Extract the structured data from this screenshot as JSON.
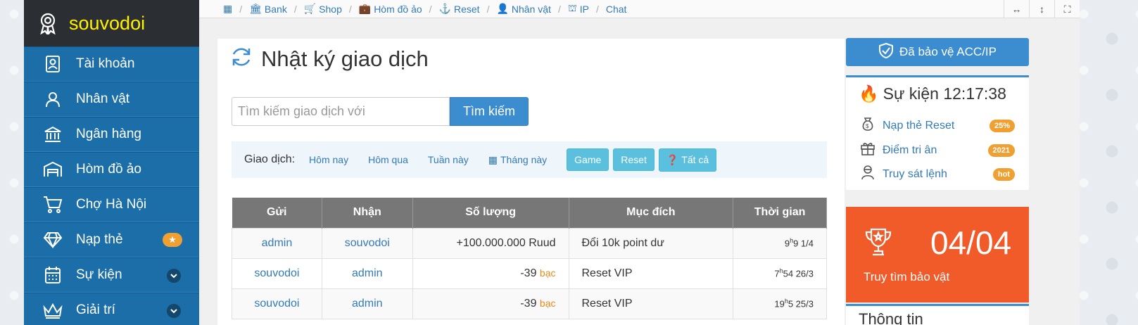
{
  "brand": {
    "name": "souvodoi"
  },
  "sidebar": {
    "items": [
      {
        "label": "Tài khoản"
      },
      {
        "label": "Nhân vật"
      },
      {
        "label": "Ngân hàng"
      },
      {
        "label": "Hòm đồ ảo"
      },
      {
        "label": "Chợ Hà Nội"
      },
      {
        "label": "Nạp thẻ"
      },
      {
        "label": "Sự kiện"
      },
      {
        "label": "Giải trí"
      }
    ]
  },
  "breadcrumb": {
    "items": [
      "Bank",
      "Shop",
      "Hòm đồ ảo",
      "Reset",
      "Nhân vật",
      "IP",
      "Chat"
    ]
  },
  "page": {
    "title": "Nhật ký giao dịch"
  },
  "search": {
    "placeholder": "Tìm kiếm giao dịch với",
    "button": "Tìm kiếm"
  },
  "filter": {
    "label": "Giao dịch:",
    "links": [
      "Hôm nay",
      "Hôm qua",
      "Tuần này",
      "Tháng này"
    ],
    "buttons": [
      "Game",
      "Reset",
      "Tất cả"
    ]
  },
  "table": {
    "headers": [
      "Gửi",
      "Nhận",
      "Số lượng",
      "Mục đích",
      "Thời gian"
    ],
    "rows": [
      {
        "from": "admin",
        "to": "souvodoi",
        "amount": "+100.000.000 Ruud",
        "unit": "",
        "purpose": "Đổi 10k point dư",
        "time_h": "9",
        "time_rest": "9 1/4"
      },
      {
        "from": "souvodoi",
        "to": "admin",
        "amount": "-39",
        "unit": "bạc",
        "purpose": "Reset VIP",
        "time_h": "7",
        "time_rest": "54 26/3"
      },
      {
        "from": "souvodoi",
        "to": "admin",
        "amount": "-39",
        "unit": "bạc",
        "purpose": "Reset VIP",
        "time_h": "19",
        "time_rest": "5 25/3"
      }
    ]
  },
  "protect": {
    "label": "Đã bảo vệ ACC/IP"
  },
  "event": {
    "title": "Sự kiện 12:17:38",
    "items": [
      {
        "label": "Nạp thẻ Reset",
        "badge": "25%"
      },
      {
        "label": "Điểm tri ân",
        "badge": "2021"
      },
      {
        "label": "Truy sát lệnh",
        "badge": "hot"
      }
    ]
  },
  "treasure": {
    "date": "04/04",
    "label": "Truy tìm bảo vật"
  },
  "next": {
    "title": "Thông tin"
  },
  "colors": {
    "sidebar": "#1b6ea8",
    "brand_text": "#fff200",
    "accent": "#3c8dd0",
    "badge": "#f0a030",
    "treasure": "#f15a29"
  },
  "time_sup": "h"
}
